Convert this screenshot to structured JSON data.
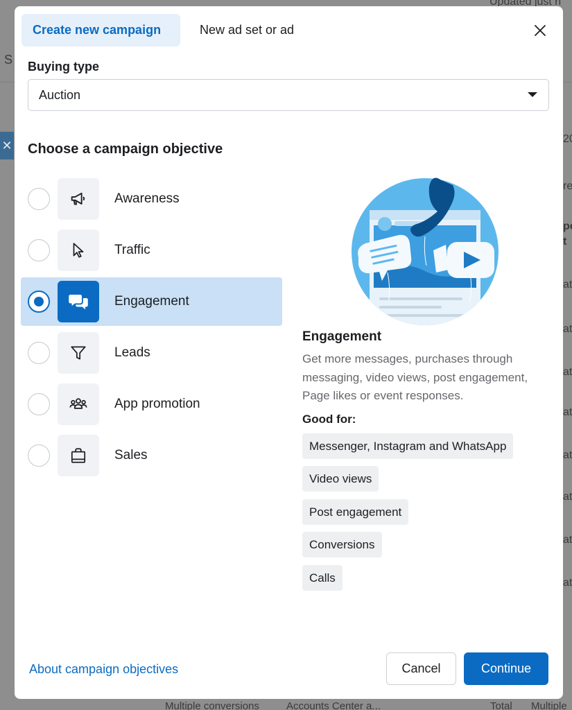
{
  "background": {
    "top_right": "Updated just n",
    "left_letter": "S",
    "right_fragments": [
      "20",
      "re",
      "pe",
      "t",
      "at",
      "at",
      "at",
      "at",
      "at",
      "at",
      "at",
      "at"
    ],
    "bottom_fragments": [
      "Multiple conversions",
      "Accounts Center a...",
      "Total",
      "Multiple"
    ]
  },
  "modal": {
    "tabs": [
      {
        "label": "Create new campaign",
        "active": true
      },
      {
        "label": "New ad set or ad",
        "active": false
      }
    ],
    "buying_type": {
      "label": "Buying type",
      "value": "Auction"
    },
    "objective_title": "Choose a campaign objective",
    "objectives": [
      {
        "label": "Awareness",
        "icon": "megaphone-icon",
        "selected": false
      },
      {
        "label": "Traffic",
        "icon": "cursor-icon",
        "selected": false
      },
      {
        "label": "Engagement",
        "icon": "chat-bubbles-icon",
        "selected": true
      },
      {
        "label": "Leads",
        "icon": "funnel-icon",
        "selected": false
      },
      {
        "label": "App promotion",
        "icon": "people-group-icon",
        "selected": false
      },
      {
        "label": "Sales",
        "icon": "shopping-bag-icon",
        "selected": false
      }
    ],
    "detail": {
      "title": "Engagement",
      "description": "Get more messages, purchases through messaging, video views, post engagement, Page likes or event responses.",
      "good_for_label": "Good for:",
      "good_for": [
        "Messenger, Instagram and WhatsApp",
        "Video views",
        "Post engagement",
        "Conversions",
        "Calls"
      ]
    },
    "footer": {
      "link": "About campaign objectives",
      "cancel": "Cancel",
      "continue": "Continue"
    }
  },
  "colors": {
    "accent": "#0b6bc3",
    "selected_bg": "#c9e0f6",
    "illustration_sky": "#5cb8ec"
  }
}
